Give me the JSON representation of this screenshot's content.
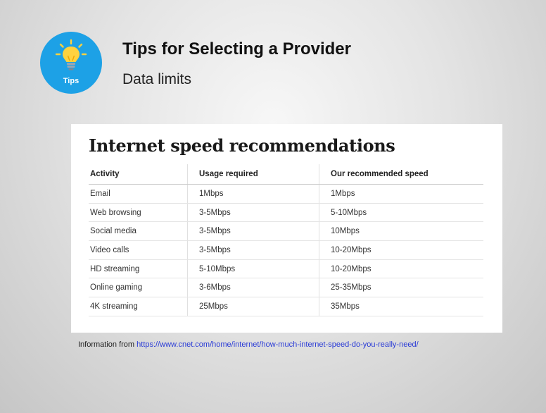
{
  "badge": {
    "icon": "lightbulb-icon",
    "label": "Tips",
    "color": "#1da1e6"
  },
  "header": {
    "title": "Tips for Selecting a Provider",
    "subtitle": "Data limits"
  },
  "card": {
    "title": "Internet speed recommendations",
    "columns": [
      "Activity",
      "Usage required",
      "Our recommended speed"
    ],
    "rows": [
      [
        "Email",
        "1Mbps",
        "1Mbps"
      ],
      [
        "Web browsing",
        "3-5Mbps",
        "5-10Mbps"
      ],
      [
        "Social media",
        "3-5Mbps",
        "10Mbps"
      ],
      [
        "Video calls",
        "3-5Mbps",
        "10-20Mbps"
      ],
      [
        "HD streaming",
        "5-10Mbps",
        "10-20Mbps"
      ],
      [
        "Online gaming",
        "3-6Mbps",
        "25-35Mbps"
      ],
      [
        "4K streaming",
        "25Mbps",
        "35Mbps"
      ]
    ]
  },
  "source": {
    "prefix": "Information from",
    "link": "https://www.cnet.com/home/internet/how-much-internet-speed-do-you-really-need/"
  }
}
